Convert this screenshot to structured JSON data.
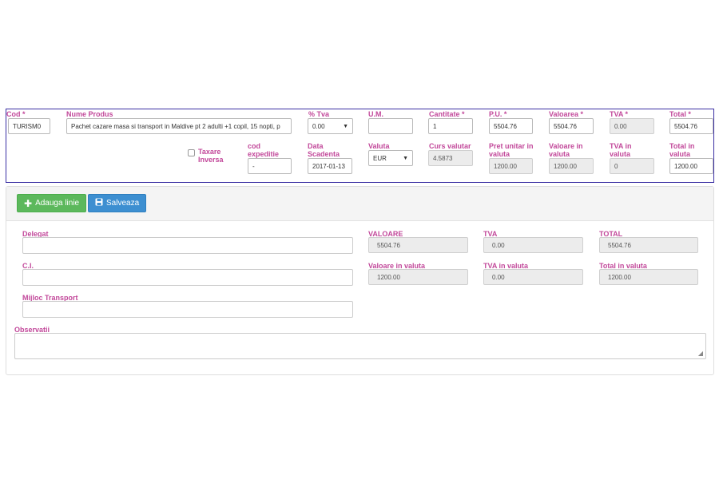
{
  "line": {
    "labels": {
      "cod": "Cod *",
      "nume_produs": "Nume Produs",
      "tva_pct": "% Tva",
      "um": "U.M.",
      "cantitate": "Cantitate *",
      "pu": "P.U. *",
      "valoarea": "Valoarea *",
      "tva": "TVA *",
      "total": "Total *",
      "taxare_inversa": "Taxare Inversa",
      "cod_expeditie": "cod expeditie",
      "data_scadenta": "Data Scadenta",
      "valuta": "Valuta",
      "curs_valutar": "Curs valutar",
      "pret_unitar_valuta": "Pret unitar in valuta",
      "valoare_valuta": "Valoare in valuta",
      "tva_valuta": "TVA in valuta",
      "total_valuta": "Total in valuta"
    },
    "values": {
      "cod": "TURISM0",
      "nume_produs": "Pachet cazare masa si transport in Maldive pt 2 adulti +1 copil, 15 nopti, p",
      "tva_pct": "0.00",
      "um": "",
      "cantitate": "1",
      "pu": "5504.76",
      "valoarea": "5504.76",
      "tva": "0.00",
      "total": "5504.76",
      "cod_expeditie": "-",
      "data_scadenta": "2017-01-13",
      "valuta": "EUR",
      "curs_valutar": "4.5873",
      "pret_unitar_valuta": "1200.00",
      "valoare_valuta": "1200.00",
      "tva_valuta": "0",
      "total_valuta": "1200.00"
    }
  },
  "toolbar": {
    "add_label": "Adauga linie",
    "save_label": "Salveaza"
  },
  "footer": {
    "labels": {
      "delegat": "Delegat",
      "ci": "C.I.",
      "mijloc_transport": "Mijloc Transport",
      "observatii": "Observatii",
      "valoare": "VALOARE",
      "tva": "TVA",
      "total": "TOTAL",
      "valoare_valuta": "Valoare in valuta",
      "tva_valuta": "TVA in valuta",
      "total_valuta": "Total in valuta"
    },
    "values": {
      "delegat": "",
      "ci": "",
      "mijloc_transport": "",
      "observatii": "",
      "valoare": "5504.76",
      "tva": "0.00",
      "total": "5504.76",
      "valoare_valuta": "1200.00",
      "tva_valuta": "0.00",
      "total_valuta": "1200.00"
    }
  },
  "icons": {
    "add": "plus-icon",
    "save": "floppy-disk-icon"
  },
  "colors": {
    "label": "#c2489a",
    "line_border": "#3a2fa3",
    "add_button": "#5cb85c",
    "save_button": "#3d8fd1"
  }
}
